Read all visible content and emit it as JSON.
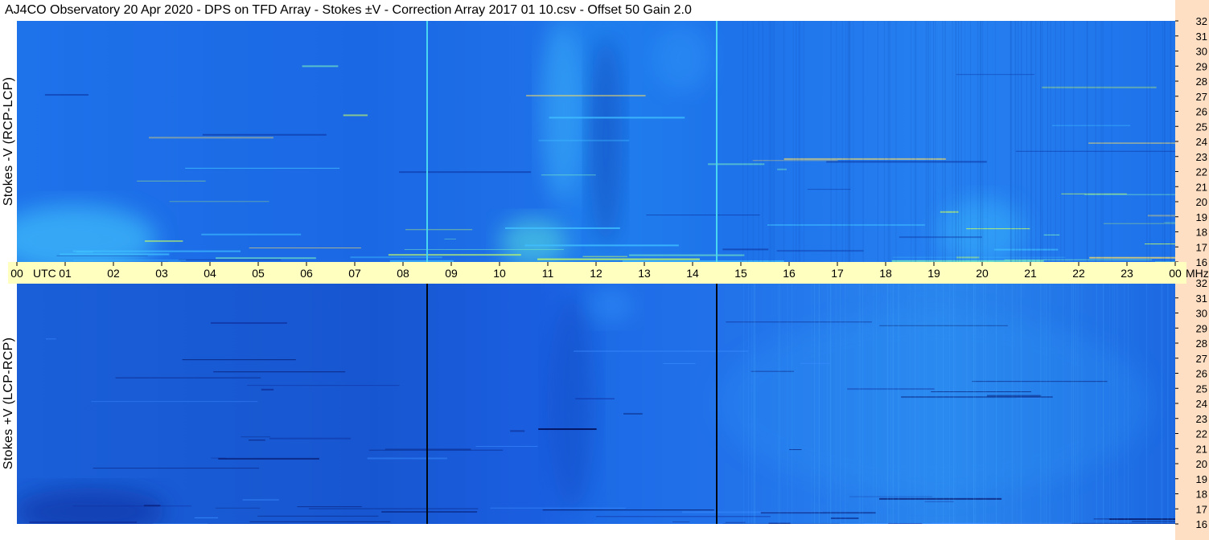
{
  "title": "AJ4CO Observatory  20 Apr 2020  -  DPS on TFD Array  -  Stokes ±V  -  Correction Array 2017 01 10.csv  -  Offset 50  Gain 2.0",
  "colors": {
    "background_blue": "#1a64e0",
    "axis_yellow": "#ffffc0",
    "strip_peach": "#ffdfc4"
  },
  "chart_data": [
    {
      "type": "heatmap",
      "panel": "top",
      "ylabel": "Stokes -V (RCP-LCP)",
      "x": [
        "00",
        "01",
        "02",
        "03",
        "04",
        "05",
        "06",
        "07",
        "08",
        "09",
        "10",
        "11",
        "12",
        "13",
        "14",
        "15",
        "16",
        "17",
        "18",
        "19",
        "20",
        "21",
        "22",
        "23",
        "00"
      ],
      "x_unit": "UTC",
      "xlim": [
        0,
        24
      ],
      "y_ticks": [
        16,
        17,
        18,
        19,
        20,
        21,
        22,
        23,
        24,
        25,
        26,
        27,
        28,
        29,
        30,
        31,
        32
      ],
      "ylim": [
        16,
        32
      ],
      "y_unit": "MHz",
      "colormap": "jet-like, mostly blue",
      "vertical_lines_utc": [
        8.5,
        14.5
      ]
    },
    {
      "type": "heatmap",
      "panel": "bottom",
      "ylabel": "Stokes +V (LCP-RCP)",
      "x": [
        "00",
        "01",
        "02",
        "03",
        "04",
        "05",
        "06",
        "07",
        "08",
        "09",
        "10",
        "11",
        "12",
        "13",
        "14",
        "15",
        "16",
        "17",
        "18",
        "19",
        "20",
        "21",
        "22",
        "23",
        "00"
      ],
      "x_unit": "UTC",
      "xlim": [
        0,
        24
      ],
      "y_ticks": [
        16,
        17,
        18,
        19,
        20,
        21,
        22,
        23,
        24,
        25,
        26,
        27,
        28,
        29,
        30,
        31,
        32
      ],
      "ylim": [
        16,
        32
      ],
      "y_unit": "MHz",
      "colormap": "jet-like, mostly blue",
      "vertical_lines_utc": [
        8.5,
        14.5
      ]
    }
  ]
}
